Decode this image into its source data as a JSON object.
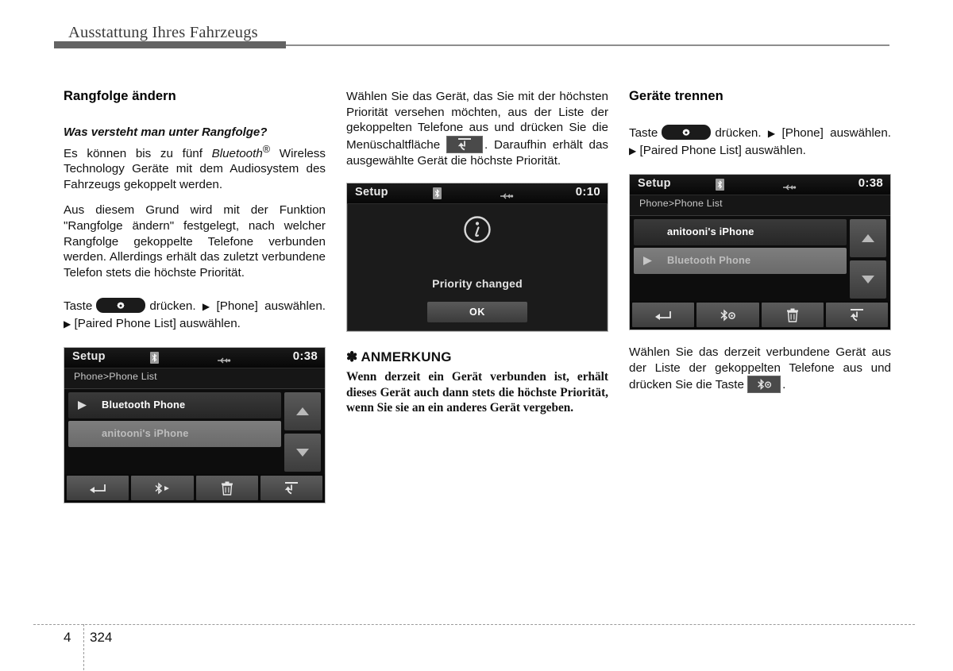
{
  "running_header": {
    "title": "Ausstattung Ihres Fahrzeugs"
  },
  "footer": {
    "chapter": "4",
    "page": "324"
  },
  "icons": {
    "gear": "gear-icon",
    "bluetooth": "bluetooth-icon",
    "usb": "usb-icon",
    "play": "play-triangle-icon",
    "back": "back-arrow-icon",
    "connect": "bluetooth-connect-icon",
    "disconnect": "bluetooth-disconnect-icon",
    "delete": "trash-icon",
    "priority": "set-priority-icon",
    "info": "info-icon",
    "scroll_up": "scroll-up-icon",
    "scroll_down": "scroll-down-icon"
  },
  "colors": {
    "rule": "#636363",
    "key_black": "#1b1b1b",
    "screen_black": "#000000",
    "row_selected": "#7e7e7e"
  },
  "column_left": {
    "heading": "Rangfolge ändern",
    "question": "Was versteht man unter Rangfolge?",
    "paragraph_1_a": "Es können bis zu fünf ",
    "paragraph_1_bt": "Bluetooth",
    "paragraph_1_sup": "®",
    "paragraph_1_b": " Wireless Technology Geräte mit dem Audiosystem des Fahrzeugs gekoppelt werden.",
    "paragraph_2": "Aus diesem Grund wird mit der Funktion \"Rangfolge ändern\" festgelegt, nach welcher Rangfolge gekoppelte Telefone verbunden werden. Allerdings erhält das zuletzt verbundene Telefon stets die höchste Priorität.",
    "key_seq": {
      "taste": "Taste",
      "druecken": "drücken.",
      "phone": "[Phone]",
      "auswaehlen_1": "auswählen.",
      "paired": "[Paired Phone List]",
      "auswaehlen_2": "auswählen."
    },
    "screen": {
      "title": "Setup",
      "clock": "0:38",
      "breadcrumb": "Phone>Phone List",
      "rows": [
        {
          "label": "Bluetooth Phone",
          "state": "dark",
          "has_play": true
        },
        {
          "label": "anitooni's iPhone",
          "state": "light",
          "has_play": false
        }
      ]
    }
  },
  "column_middle": {
    "paragraph_a": "Wählen Sie das Gerät, das Sie mit der höchsten Priorität versehen möchten, aus der Liste der gekoppelten Telefone aus und drücken Sie die Menüschaltfläche",
    "paragraph_b": ". Daraufhin erhält das ausgewählte Gerät die höchste Priorität.",
    "screen": {
      "title": "Setup",
      "clock": "0:10",
      "message": "Priority changed",
      "ok_label": "OK"
    },
    "note": {
      "asterisk": "✽",
      "heading": "ANMERKUNG",
      "body": "Wenn derzeit ein Gerät verbunden ist, erhält dieses Gerät auch dann stets die höchste Priorität, wenn Sie sie an ein anderes Gerät vergeben."
    }
  },
  "column_right": {
    "heading": "Geräte trennen",
    "key_seq": {
      "taste": "Taste",
      "druecken": "drücken.",
      "phone": "[Phone]",
      "auswaehlen_1": "auswählen.",
      "paired": "[Paired Phone List]",
      "auswaehlen_2": "auswählen."
    },
    "screen": {
      "title": "Setup",
      "clock": "0:38",
      "breadcrumb": "Phone>Phone List",
      "rows": [
        {
          "label": "anitooni's iPhone",
          "state": "dark",
          "has_play": false
        },
        {
          "label": "Bluetooth Phone",
          "state": "light",
          "has_play": true
        }
      ]
    },
    "paragraph_a": "Wählen Sie das derzeit verbundene Gerät aus der Liste der gekoppelten Telefone aus und drücken Sie die Taste",
    "paragraph_b": "."
  }
}
